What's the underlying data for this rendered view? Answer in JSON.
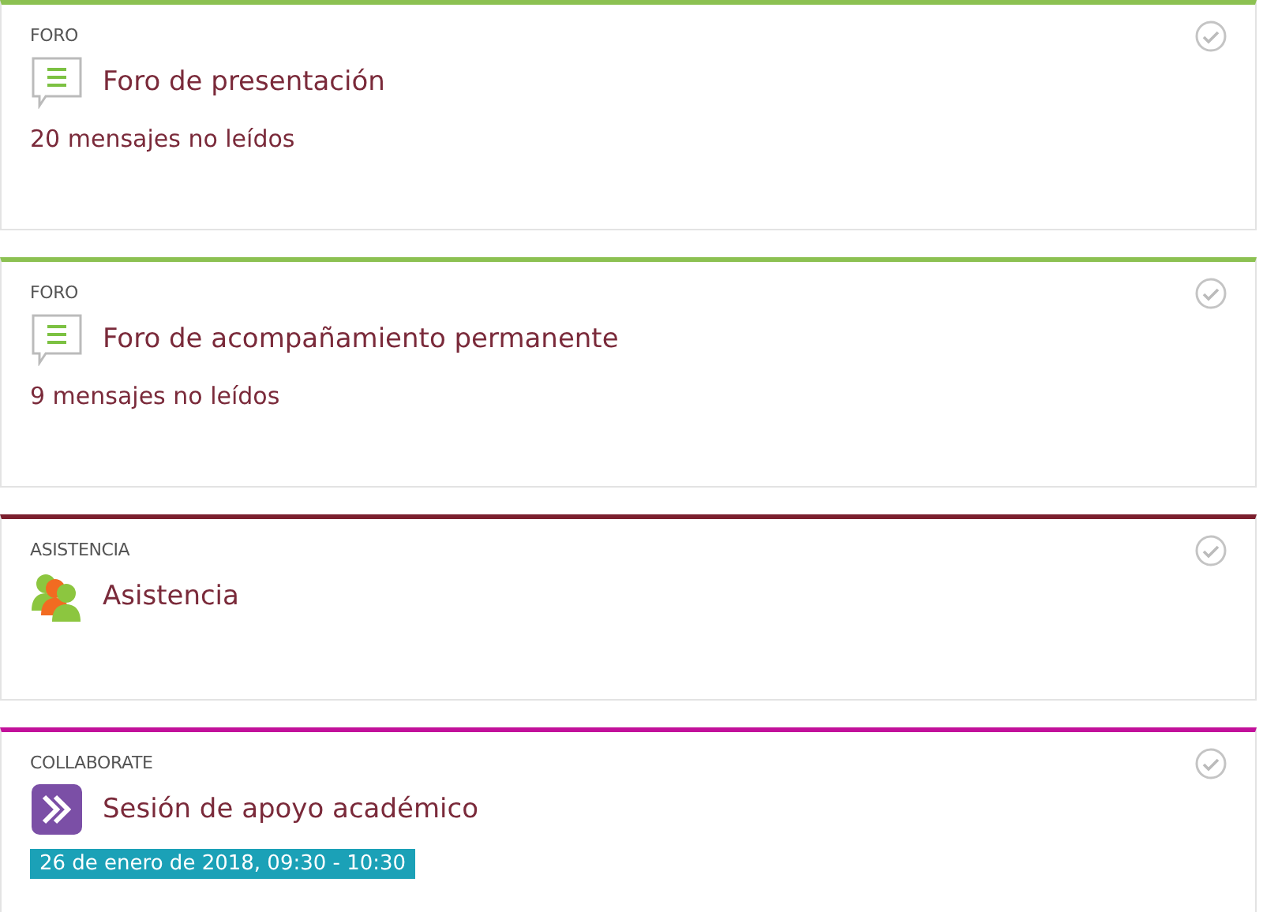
{
  "activities": [
    {
      "kind": "forum",
      "color": "#8cc152",
      "category": "FORO",
      "title": "Foro de presentación",
      "unread": "20 mensajes no leídos"
    },
    {
      "kind": "forum",
      "color": "#8cc152",
      "category": "FORO",
      "title": "Foro de acompañamiento permanente",
      "unread": "9 mensajes no leídos"
    },
    {
      "kind": "attendance",
      "color": "#7b1f2e",
      "category": "ASISTENCIA",
      "title": "Asistencia"
    },
    {
      "kind": "collaborate",
      "color": "#c2119a",
      "category": "COLLABORATE",
      "title": "Sesión de apoyo académico",
      "date": "26 de enero de 2018, 09:30 - 10:30"
    }
  ]
}
